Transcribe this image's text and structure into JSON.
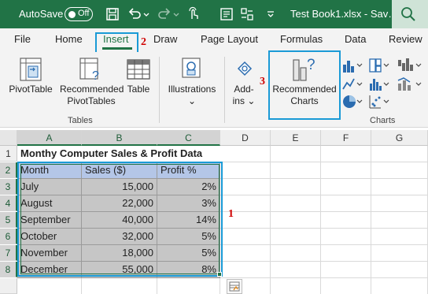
{
  "titlebar": {
    "autosave_label": "AutoSave",
    "autosave_state": "Off",
    "document_title": "Test Book1.xlsx  -  Sav…",
    "icons": [
      "save-icon",
      "undo-icon",
      "redo-icon",
      "touch-mode-icon",
      "form-icon",
      "customize-icon",
      "search-icon"
    ]
  },
  "tabs": [
    {
      "label": "File"
    },
    {
      "label": "Home"
    },
    {
      "label": "Insert",
      "active": true
    },
    {
      "label": "Draw"
    },
    {
      "label": "Page Layout"
    },
    {
      "label": "Formulas"
    },
    {
      "label": "Data"
    },
    {
      "label": "Review"
    }
  ],
  "ribbon": {
    "tables_group": {
      "label": "Tables",
      "buttons": [
        {
          "line1": "PivotTable",
          "line2": ""
        },
        {
          "line1": "Recommended",
          "line2": "PivotTables"
        },
        {
          "line1": "Table",
          "line2": ""
        }
      ]
    },
    "illustrations": {
      "label": "Illustrations",
      "chevron": "⌄"
    },
    "addins": {
      "line1": "Add-",
      "line2": "ins",
      "chevron": "⌄"
    },
    "recommended_charts": {
      "line1": "Recommended",
      "line2": "Charts"
    },
    "charts_group": {
      "label": "Charts"
    }
  },
  "annotations": {
    "insert": "2",
    "data": "1",
    "charts": "3"
  },
  "grid": {
    "columns": [
      "A",
      "B",
      "C",
      "D",
      "E",
      "F",
      "G"
    ],
    "rows": [
      "1",
      "2",
      "3",
      "4",
      "5",
      "6",
      "7",
      "8"
    ],
    "title": "Monthy Computer Sales & Profit Data",
    "headers": [
      "Month",
      "Sales ($)",
      "Profit %"
    ],
    "data": [
      [
        "July",
        "15,000",
        "2%"
      ],
      [
        "August",
        "22,000",
        "3%"
      ],
      [
        "September",
        "40,000",
        "14%"
      ],
      [
        "October",
        "32,000",
        "5%"
      ],
      [
        "November",
        "18,000",
        "5%"
      ],
      [
        "December",
        "55,000",
        "8%"
      ]
    ]
  },
  "colors": {
    "excel_green": "#217346",
    "highlight_blue": "#1a9ad6",
    "annotation_red": "#d00000",
    "header_fill": "#b4c6e7"
  }
}
